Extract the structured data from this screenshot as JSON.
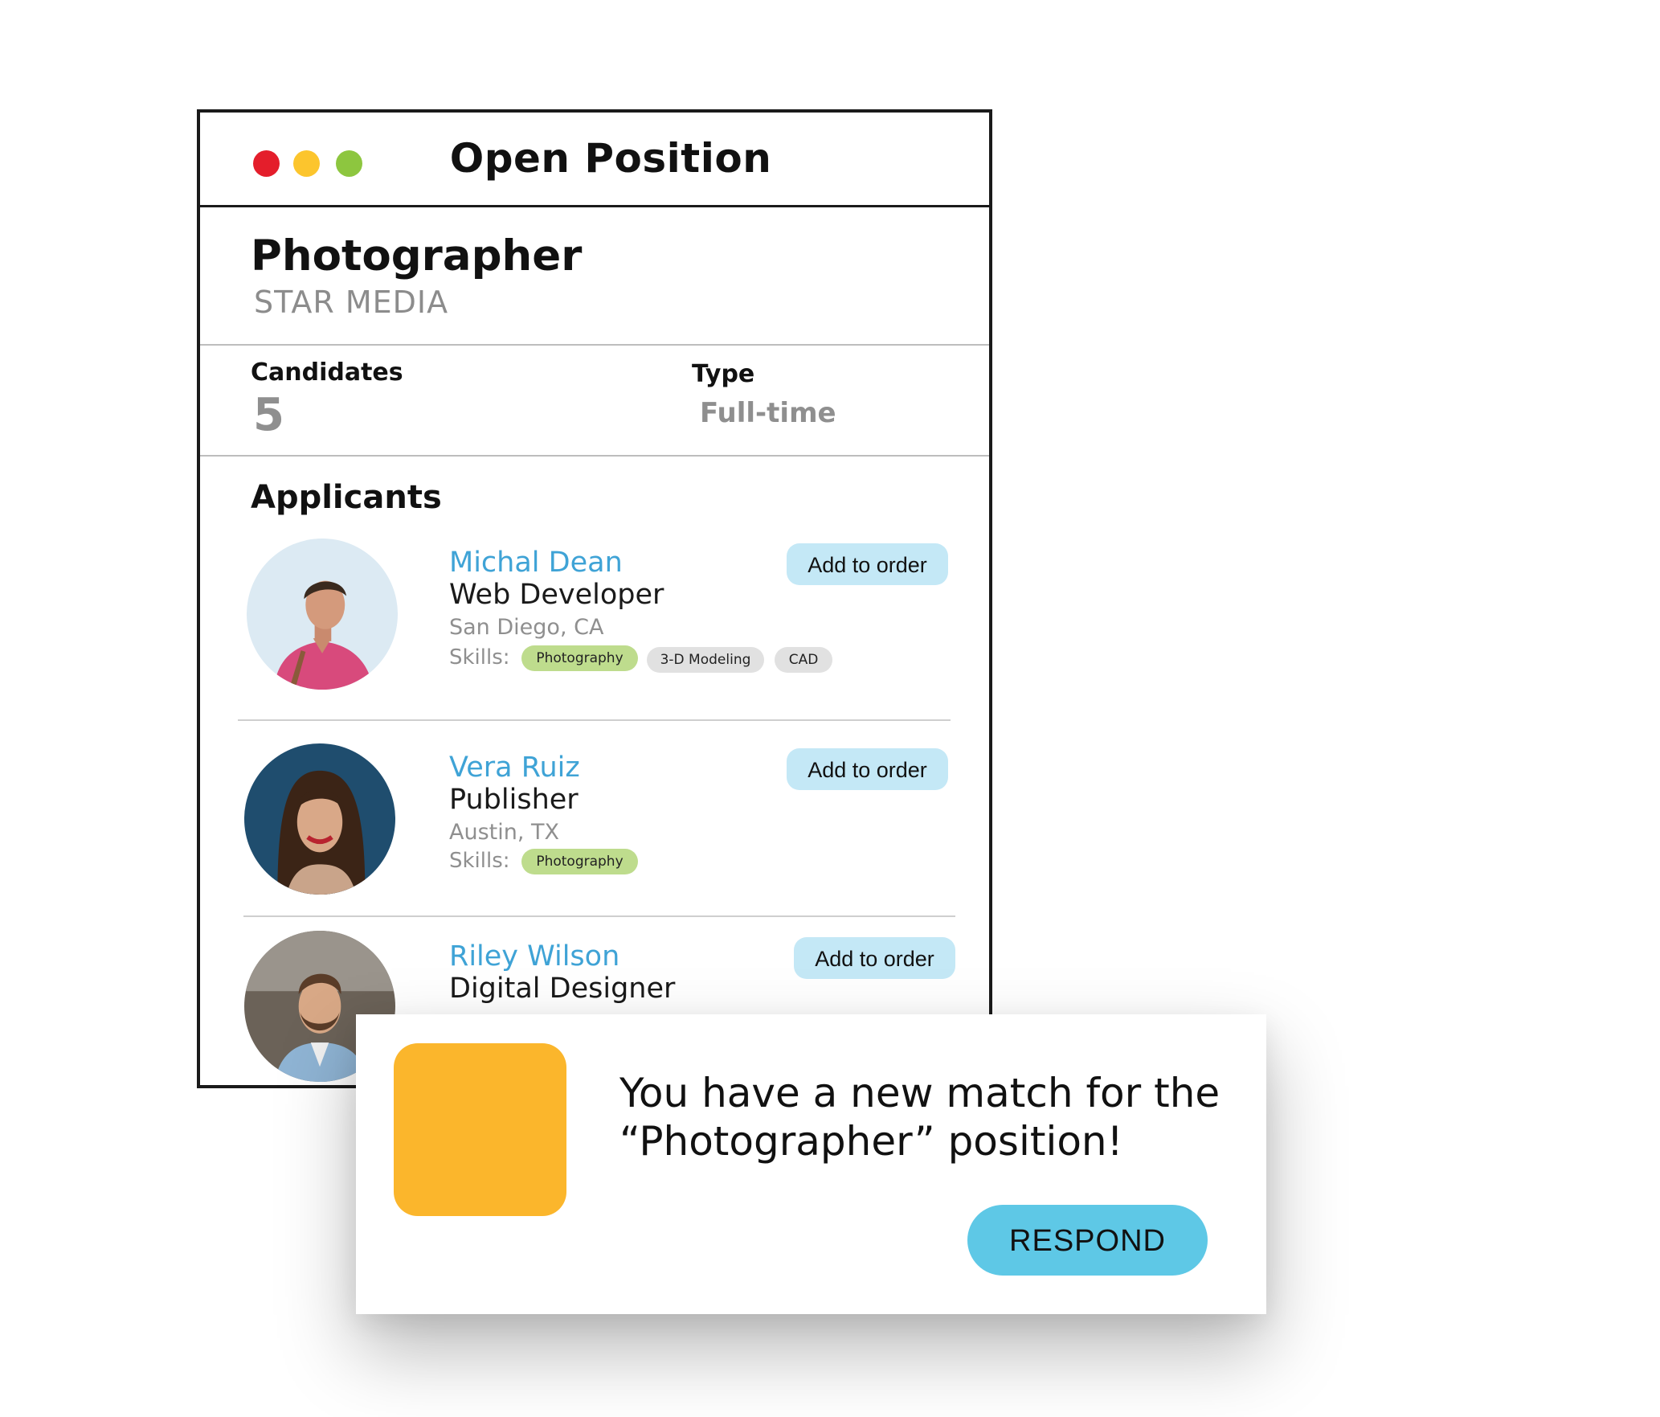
{
  "window": {
    "title": "Open Position",
    "controls": [
      {
        "name": "close",
        "color": "#e41e2b"
      },
      {
        "name": "minimize",
        "color": "#fcc52d"
      },
      {
        "name": "maximize",
        "color": "#8dc63f"
      }
    ]
  },
  "job": {
    "title": "Photographer",
    "company": "STAR MEDIA"
  },
  "stats": {
    "candidates_label": "Candidates",
    "candidates_value": "5",
    "type_label": "Type",
    "type_value": "Full-time"
  },
  "applicants": {
    "heading": "Applicants",
    "button_label": "Add to order",
    "skills_label": "Skills:",
    "items": [
      {
        "name": "Michal Dean",
        "role": "Web Developer",
        "location": "San Diego, CA",
        "skills": [
          "Photography",
          "3-D Modeling",
          "CAD"
        ]
      },
      {
        "name": "Vera Ruiz",
        "role": "Publisher",
        "location": "Austin, TX",
        "skills": [
          "Photography"
        ]
      },
      {
        "name": "Riley Wilson",
        "role": "Digital Designer"
      }
    ]
  },
  "notification": {
    "message": "You have a new match for the “Photographer” position!",
    "button_label": "RESPOND",
    "icon_color": "#fbb62c",
    "button_color": "#5ec8e6"
  },
  "colors": {
    "name_link": "#3fa3d6",
    "skill_highlight": "#bedc8d",
    "skill_default": "#e1e1e1",
    "add_button": "#c4e8f6"
  }
}
